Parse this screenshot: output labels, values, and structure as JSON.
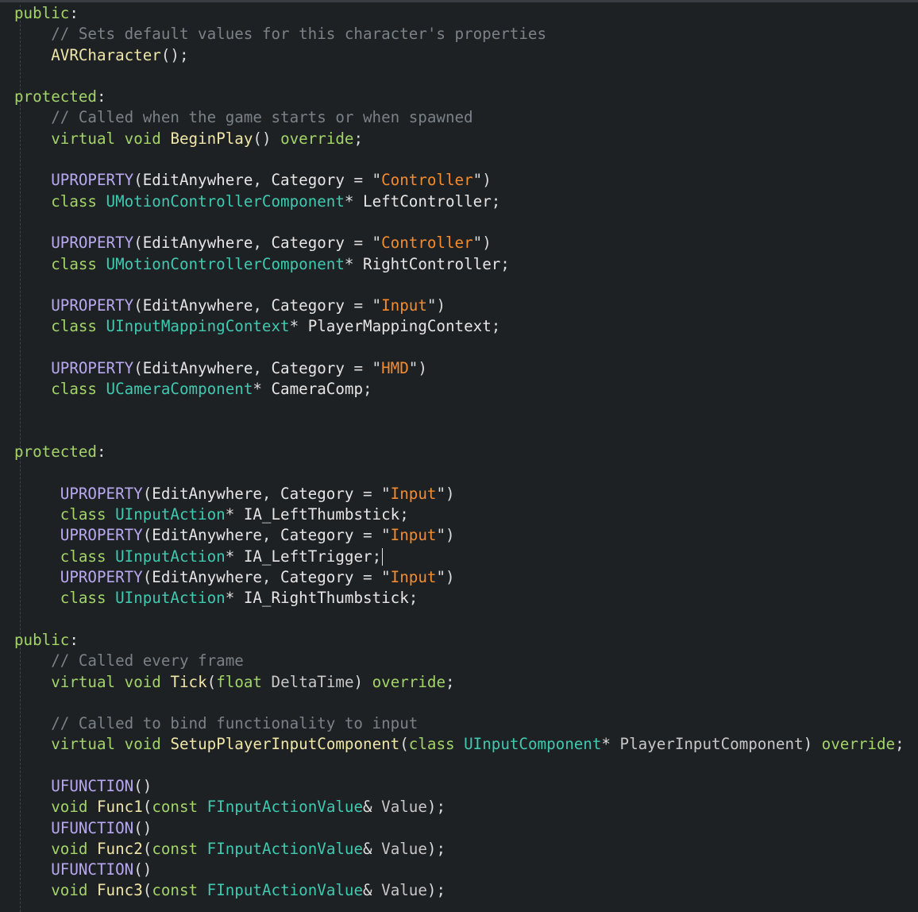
{
  "editor": {
    "language": "C++",
    "colors": {
      "background": "#1e2124",
      "access_specifier": "#a3d468",
      "keyword": "#a3d468",
      "comment": "#7a8288",
      "macro": "#b7a8f0",
      "type": "#3fc9b0",
      "function": "#f0e6a8",
      "string": "#f38b2f",
      "identifier": "#e6e6e6"
    },
    "lines": [
      [
        {
          "k": "kw",
          "t": "public"
        },
        {
          "k": "punct",
          "t": ":"
        }
      ],
      [
        {
          "k": "ws",
          "t": "    "
        },
        {
          "k": "comment",
          "t": "// Sets default values for this character's properties"
        }
      ],
      [
        {
          "k": "ws",
          "t": "    "
        },
        {
          "k": "func",
          "t": "AVRCharacter"
        },
        {
          "k": "punct",
          "t": "();"
        }
      ],
      [],
      [
        {
          "k": "kw",
          "t": "protected"
        },
        {
          "k": "punct",
          "t": ":"
        }
      ],
      [
        {
          "k": "ws",
          "t": "    "
        },
        {
          "k": "comment",
          "t": "// Called when the game starts or when spawned"
        }
      ],
      [
        {
          "k": "ws",
          "t": "    "
        },
        {
          "k": "keyword",
          "t": "virtual"
        },
        {
          "k": "ws",
          "t": " "
        },
        {
          "k": "keyword",
          "t": "void"
        },
        {
          "k": "ws",
          "t": " "
        },
        {
          "k": "func",
          "t": "BeginPlay"
        },
        {
          "k": "punct",
          "t": "() "
        },
        {
          "k": "keyword",
          "t": "override"
        },
        {
          "k": "punct",
          "t": ";"
        }
      ],
      [],
      [
        {
          "k": "ws",
          "t": "    "
        },
        {
          "k": "macro",
          "t": "UPROPERTY"
        },
        {
          "k": "punct",
          "t": "("
        },
        {
          "k": "ident",
          "t": "EditAnywhere"
        },
        {
          "k": "punct",
          "t": ", "
        },
        {
          "k": "ident",
          "t": "Category"
        },
        {
          "k": "punct",
          "t": " = \""
        },
        {
          "k": "str",
          "t": "Controller"
        },
        {
          "k": "punct",
          "t": "\")"
        }
      ],
      [
        {
          "k": "ws",
          "t": "    "
        },
        {
          "k": "keyword",
          "t": "class"
        },
        {
          "k": "ws",
          "t": " "
        },
        {
          "k": "type",
          "t": "UMotionControllerComponent"
        },
        {
          "k": "punct",
          "t": "* "
        },
        {
          "k": "ident",
          "t": "LeftController"
        },
        {
          "k": "punct",
          "t": ";"
        }
      ],
      [],
      [
        {
          "k": "ws",
          "t": "    "
        },
        {
          "k": "macro",
          "t": "UPROPERTY"
        },
        {
          "k": "punct",
          "t": "("
        },
        {
          "k": "ident",
          "t": "EditAnywhere"
        },
        {
          "k": "punct",
          "t": ", "
        },
        {
          "k": "ident",
          "t": "Category"
        },
        {
          "k": "punct",
          "t": " = \""
        },
        {
          "k": "str",
          "t": "Controller"
        },
        {
          "k": "punct",
          "t": "\")"
        }
      ],
      [
        {
          "k": "ws",
          "t": "    "
        },
        {
          "k": "keyword",
          "t": "class"
        },
        {
          "k": "ws",
          "t": " "
        },
        {
          "k": "type",
          "t": "UMotionControllerComponent"
        },
        {
          "k": "punct",
          "t": "* "
        },
        {
          "k": "ident",
          "t": "RightController"
        },
        {
          "k": "punct",
          "t": ";"
        }
      ],
      [],
      [
        {
          "k": "ws",
          "t": "    "
        },
        {
          "k": "macro",
          "t": "UPROPERTY"
        },
        {
          "k": "punct",
          "t": "("
        },
        {
          "k": "ident",
          "t": "EditAnywhere"
        },
        {
          "k": "punct",
          "t": ", "
        },
        {
          "k": "ident",
          "t": "Category"
        },
        {
          "k": "punct",
          "t": " = \""
        },
        {
          "k": "str",
          "t": "Input"
        },
        {
          "k": "punct",
          "t": "\")"
        }
      ],
      [
        {
          "k": "ws",
          "t": "    "
        },
        {
          "k": "keyword",
          "t": "class"
        },
        {
          "k": "ws",
          "t": " "
        },
        {
          "k": "type",
          "t": "UInputMappingContext"
        },
        {
          "k": "punct",
          "t": "* "
        },
        {
          "k": "ident",
          "t": "PlayerMappingContext"
        },
        {
          "k": "punct",
          "t": ";"
        }
      ],
      [],
      [
        {
          "k": "ws",
          "t": "    "
        },
        {
          "k": "macro",
          "t": "UPROPERTY"
        },
        {
          "k": "punct",
          "t": "("
        },
        {
          "k": "ident",
          "t": "EditAnywhere"
        },
        {
          "k": "punct",
          "t": ", "
        },
        {
          "k": "ident",
          "t": "Category"
        },
        {
          "k": "punct",
          "t": " = \""
        },
        {
          "k": "str",
          "t": "HMD"
        },
        {
          "k": "punct",
          "t": "\")"
        }
      ],
      [
        {
          "k": "ws",
          "t": "    "
        },
        {
          "k": "keyword",
          "t": "class"
        },
        {
          "k": "ws",
          "t": " "
        },
        {
          "k": "type",
          "t": "UCameraComponent"
        },
        {
          "k": "punct",
          "t": "* "
        },
        {
          "k": "ident",
          "t": "CameraComp"
        },
        {
          "k": "punct",
          "t": ";"
        }
      ],
      [],
      [],
      [
        {
          "k": "kw",
          "t": "protected"
        },
        {
          "k": "punct",
          "t": ":"
        }
      ],
      [],
      [
        {
          "k": "ws",
          "t": "     "
        },
        {
          "k": "macro",
          "t": "UPROPERTY"
        },
        {
          "k": "punct",
          "t": "("
        },
        {
          "k": "ident",
          "t": "EditAnywhere"
        },
        {
          "k": "punct",
          "t": ", "
        },
        {
          "k": "ident",
          "t": "Category"
        },
        {
          "k": "punct",
          "t": " = \""
        },
        {
          "k": "str",
          "t": "Input"
        },
        {
          "k": "punct",
          "t": "\")"
        }
      ],
      [
        {
          "k": "ws",
          "t": "     "
        },
        {
          "k": "keyword",
          "t": "class"
        },
        {
          "k": "ws",
          "t": " "
        },
        {
          "k": "type",
          "t": "UInputAction"
        },
        {
          "k": "punct",
          "t": "* "
        },
        {
          "k": "ident",
          "t": "IA_LeftThumbstick"
        },
        {
          "k": "punct",
          "t": ";"
        }
      ],
      [
        {
          "k": "ws",
          "t": "     "
        },
        {
          "k": "macro",
          "t": "UPROPERTY"
        },
        {
          "k": "punct",
          "t": "("
        },
        {
          "k": "ident",
          "t": "EditAnywhere"
        },
        {
          "k": "punct",
          "t": ", "
        },
        {
          "k": "ident",
          "t": "Category"
        },
        {
          "k": "punct",
          "t": " = \""
        },
        {
          "k": "str",
          "t": "Input"
        },
        {
          "k": "punct",
          "t": "\")"
        }
      ],
      [
        {
          "k": "ws",
          "t": "     "
        },
        {
          "k": "keyword",
          "t": "class"
        },
        {
          "k": "ws",
          "t": " "
        },
        {
          "k": "type",
          "t": "UInputAction"
        },
        {
          "k": "punct",
          "t": "* "
        },
        {
          "k": "ident",
          "t": "IA_LeftTrigger"
        },
        {
          "k": "punct",
          "t": ";"
        },
        {
          "k": "caret",
          "t": ""
        }
      ],
      [
        {
          "k": "ws",
          "t": "     "
        },
        {
          "k": "macro",
          "t": "UPROPERTY"
        },
        {
          "k": "punct",
          "t": "("
        },
        {
          "k": "ident",
          "t": "EditAnywhere"
        },
        {
          "k": "punct",
          "t": ", "
        },
        {
          "k": "ident",
          "t": "Category"
        },
        {
          "k": "punct",
          "t": " = \""
        },
        {
          "k": "str",
          "t": "Input"
        },
        {
          "k": "punct",
          "t": "\")"
        }
      ],
      [
        {
          "k": "ws",
          "t": "     "
        },
        {
          "k": "keyword",
          "t": "class"
        },
        {
          "k": "ws",
          "t": " "
        },
        {
          "k": "type",
          "t": "UInputAction"
        },
        {
          "k": "punct",
          "t": "* "
        },
        {
          "k": "ident",
          "t": "IA_RightThumbstick"
        },
        {
          "k": "punct",
          "t": ";"
        }
      ],
      [],
      [
        {
          "k": "kw",
          "t": "public"
        },
        {
          "k": "punct",
          "t": ":"
        }
      ],
      [
        {
          "k": "ws",
          "t": "    "
        },
        {
          "k": "comment",
          "t": "// Called every frame"
        }
      ],
      [
        {
          "k": "ws",
          "t": "    "
        },
        {
          "k": "keyword",
          "t": "virtual"
        },
        {
          "k": "ws",
          "t": " "
        },
        {
          "k": "keyword",
          "t": "void"
        },
        {
          "k": "ws",
          "t": " "
        },
        {
          "k": "func",
          "t": "Tick"
        },
        {
          "k": "punct",
          "t": "("
        },
        {
          "k": "keyword",
          "t": "float"
        },
        {
          "k": "ws",
          "t": " "
        },
        {
          "k": "param",
          "t": "DeltaTime"
        },
        {
          "k": "punct",
          "t": ") "
        },
        {
          "k": "keyword",
          "t": "override"
        },
        {
          "k": "punct",
          "t": ";"
        }
      ],
      [],
      [
        {
          "k": "ws",
          "t": "    "
        },
        {
          "k": "comment",
          "t": "// Called to bind functionality to input"
        }
      ],
      [
        {
          "k": "ws",
          "t": "    "
        },
        {
          "k": "keyword",
          "t": "virtual"
        },
        {
          "k": "ws",
          "t": " "
        },
        {
          "k": "keyword",
          "t": "void"
        },
        {
          "k": "ws",
          "t": " "
        },
        {
          "k": "func",
          "t": "SetupPlayerInputComponent"
        },
        {
          "k": "punct",
          "t": "("
        },
        {
          "k": "keyword",
          "t": "class"
        },
        {
          "k": "ws",
          "t": " "
        },
        {
          "k": "type",
          "t": "UInputComponent"
        },
        {
          "k": "punct",
          "t": "* "
        },
        {
          "k": "param",
          "t": "PlayerInputComponent"
        },
        {
          "k": "punct",
          "t": ") "
        },
        {
          "k": "keyword",
          "t": "override"
        },
        {
          "k": "punct",
          "t": ";"
        }
      ],
      [],
      [
        {
          "k": "ws",
          "t": "    "
        },
        {
          "k": "macro",
          "t": "UFUNCTION"
        },
        {
          "k": "punct",
          "t": "()"
        }
      ],
      [
        {
          "k": "ws",
          "t": "    "
        },
        {
          "k": "keyword",
          "t": "void"
        },
        {
          "k": "ws",
          "t": " "
        },
        {
          "k": "func",
          "t": "Func1"
        },
        {
          "k": "punct",
          "t": "("
        },
        {
          "k": "keyword",
          "t": "const"
        },
        {
          "k": "ws",
          "t": " "
        },
        {
          "k": "type",
          "t": "FInputActionValue"
        },
        {
          "k": "punct",
          "t": "& "
        },
        {
          "k": "param",
          "t": "Value"
        },
        {
          "k": "punct",
          "t": ");"
        }
      ],
      [
        {
          "k": "ws",
          "t": "    "
        },
        {
          "k": "macro",
          "t": "UFUNCTION"
        },
        {
          "k": "punct",
          "t": "()"
        }
      ],
      [
        {
          "k": "ws",
          "t": "    "
        },
        {
          "k": "keyword",
          "t": "void"
        },
        {
          "k": "ws",
          "t": " "
        },
        {
          "k": "func",
          "t": "Func2"
        },
        {
          "k": "punct",
          "t": "("
        },
        {
          "k": "keyword",
          "t": "const"
        },
        {
          "k": "ws",
          "t": " "
        },
        {
          "k": "type",
          "t": "FInputActionValue"
        },
        {
          "k": "punct",
          "t": "& "
        },
        {
          "k": "param",
          "t": "Value"
        },
        {
          "k": "punct",
          "t": ");"
        }
      ],
      [
        {
          "k": "ws",
          "t": "    "
        },
        {
          "k": "macro",
          "t": "UFUNCTION"
        },
        {
          "k": "punct",
          "t": "()"
        }
      ],
      [
        {
          "k": "ws",
          "t": "    "
        },
        {
          "k": "keyword",
          "t": "void"
        },
        {
          "k": "ws",
          "t": " "
        },
        {
          "k": "func",
          "t": "Func3"
        },
        {
          "k": "punct",
          "t": "("
        },
        {
          "k": "keyword",
          "t": "const"
        },
        {
          "k": "ws",
          "t": " "
        },
        {
          "k": "type",
          "t": "FInputActionValue"
        },
        {
          "k": "punct",
          "t": "& "
        },
        {
          "k": "param",
          "t": "Value"
        },
        {
          "k": "punct",
          "t": ");"
        }
      ]
    ]
  }
}
